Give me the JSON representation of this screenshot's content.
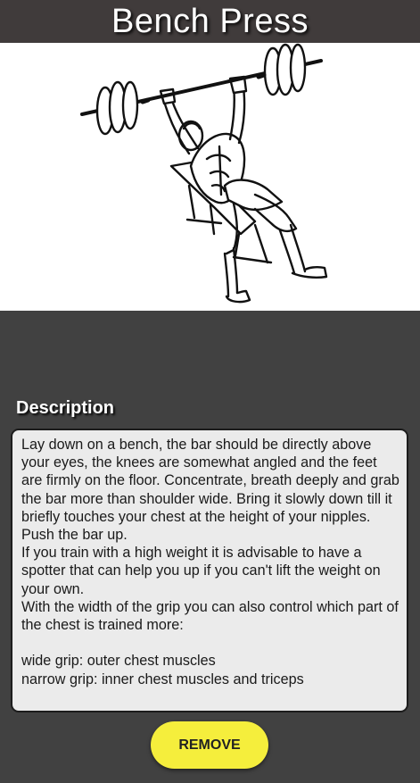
{
  "header": {
    "title": "Bench Press"
  },
  "exercise_image": {
    "subject": "bench-press-illustration-icon"
  },
  "description": {
    "heading": "Description",
    "text": "Lay down on a bench, the bar should be directly above your eyes, the knees are somewhat angled and the feet are firmly on the floor. Concentrate, breath deeply and grab the bar more than shoulder wide. Bring it slowly down till it briefly touches your chest at the height of your nipples. Push the bar up.\nIf you train with a high weight it is advisable to have a spotter that can help you up if you can't lift the weight on your own.\nWith the width of the grip you can also control which part of the chest is trained more:\n\nwide grip: outer chest muscles\nnarrow grip: inner chest muscles and triceps"
  },
  "actions": {
    "remove_label": "REMOVE"
  },
  "colors": {
    "background": "#414141",
    "header": "#403b3b",
    "button": "#f5ee3c",
    "description_box": "#ebebeb"
  }
}
